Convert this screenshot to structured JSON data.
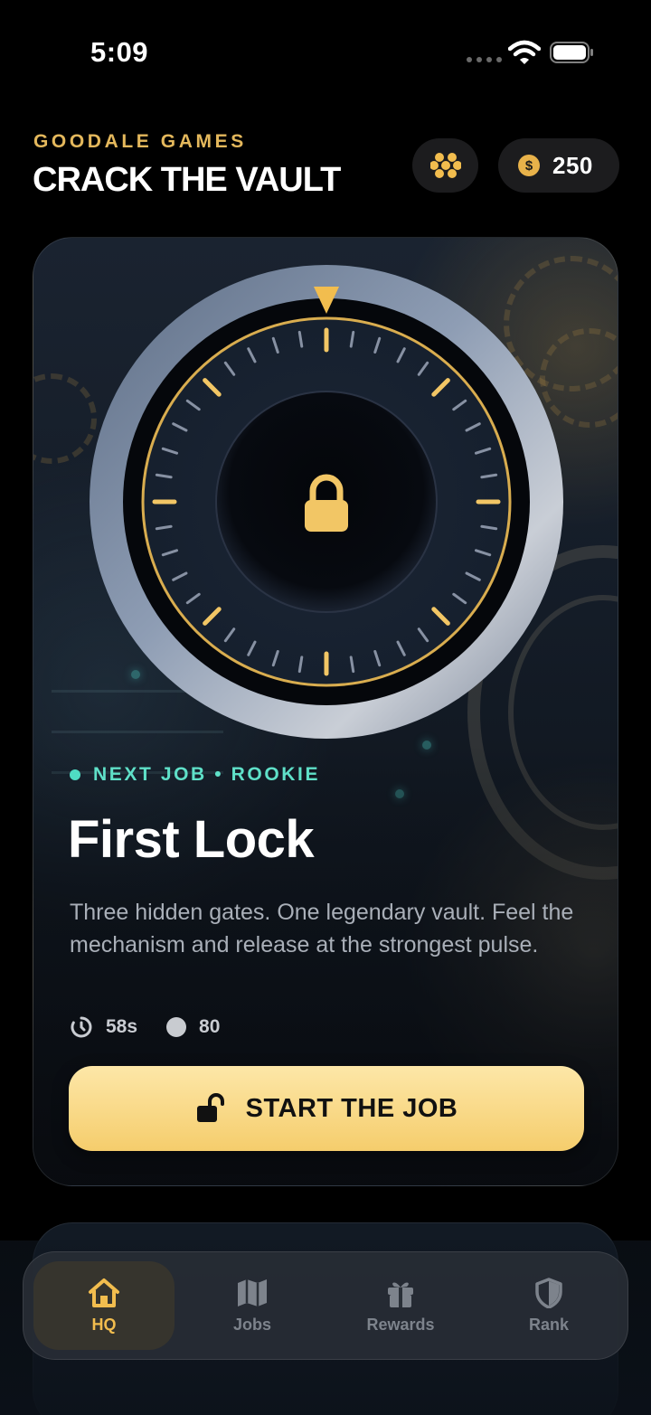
{
  "status_bar": {
    "time": "5:09"
  },
  "header": {
    "brand": "GOODALE GAMES",
    "title": "CRACK THE VAULT",
    "coins": "250",
    "coin_symbol": "$"
  },
  "job_card": {
    "tag": "NEXT JOB • ROOKIE",
    "title": "First Lock",
    "description": "Three hidden gates. One legendary vault. Feel the mechanism and release at the strongest pulse.",
    "time_limit": "58s",
    "points": "80",
    "start_label": "START THE JOB"
  },
  "tabs": [
    {
      "label": "HQ",
      "icon": "home-icon",
      "active": true
    },
    {
      "label": "Jobs",
      "icon": "map-icon",
      "active": false
    },
    {
      "label": "Rewards",
      "icon": "gift-icon",
      "active": false
    },
    {
      "label": "Rank",
      "icon": "shield-icon",
      "active": false
    }
  ],
  "colors": {
    "accent_gold": "#f2bd4e",
    "tag_teal": "#5fe0c8",
    "button_gold": "#f5cd6c",
    "background": "#000000"
  }
}
